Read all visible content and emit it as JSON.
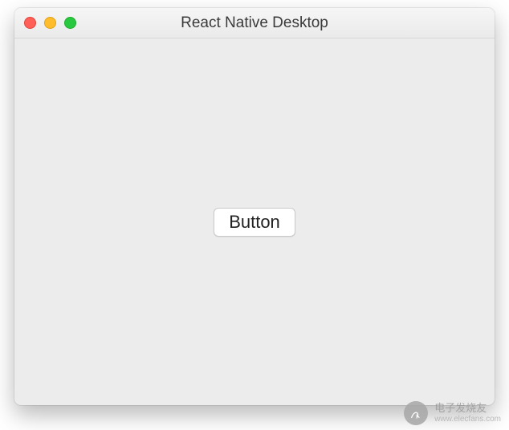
{
  "window": {
    "title": "React Native Desktop"
  },
  "content": {
    "button_label": "Button"
  },
  "watermark": {
    "name_cn": "电子发烧友",
    "url": "www.elecfans.com"
  }
}
